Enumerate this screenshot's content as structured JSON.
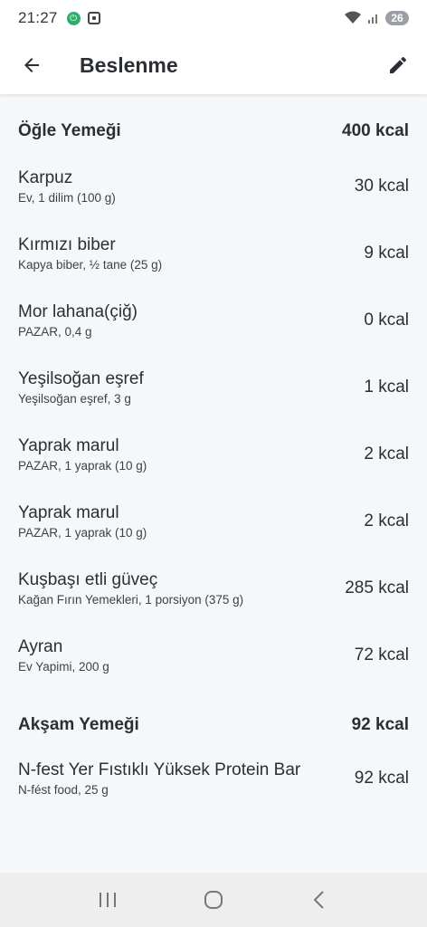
{
  "status": {
    "time": "21:27",
    "battery": "26"
  },
  "header": {
    "title": "Beslenme"
  },
  "meals": [
    {
      "name": "Öğle Yemeği",
      "total": "400 kcal",
      "items": [
        {
          "name": "Karpuz",
          "detail": "Ev, 1 dilim (100 g)",
          "kcal": "30 kcal"
        },
        {
          "name": "Kırmızı biber",
          "detail": "Kapya biber, ½ tane (25 g)",
          "kcal": "9 kcal"
        },
        {
          "name": "Mor lahana(çiğ)",
          "detail": "PAZAR, 0,4 g",
          "kcal": "0 kcal"
        },
        {
          "name": "Yeşilsoğan eşref",
          "detail": "Yeşilsoğan eşref, 3 g",
          "kcal": "1 kcal"
        },
        {
          "name": "Yaprak marul",
          "detail": "PAZAR, 1 yaprak (10 g)",
          "kcal": "2 kcal"
        },
        {
          "name": "Yaprak marul",
          "detail": "PAZAR, 1 yaprak (10 g)",
          "kcal": "2 kcal"
        },
        {
          "name": "Kuşbaşı etli güveç",
          "detail": "Kağan Fırın Yemekleri, 1 porsiyon (375 g)",
          "kcal": "285 kcal"
        },
        {
          "name": "Ayran",
          "detail": "Ev Yapimi, 200 g",
          "kcal": "72 kcal"
        }
      ]
    },
    {
      "name": "Akşam Yemeği",
      "total": "92 kcal",
      "items": [
        {
          "name": "N-fest Yer Fıstıklı Yüksek Protein Bar",
          "detail": "N-fést food, 25 g",
          "kcal": "92 kcal"
        }
      ]
    }
  ],
  "icons": {
    "back": "arrow-back-icon",
    "edit": "pencil-icon",
    "nav_recents": "recents-icon",
    "nav_home": "home-icon",
    "nav_back": "nav-back-icon"
  }
}
